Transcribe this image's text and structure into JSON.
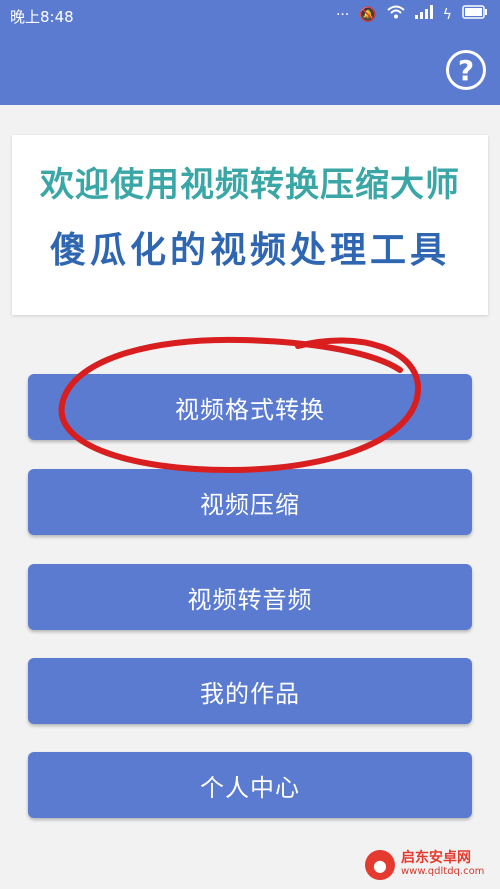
{
  "status_bar": {
    "time": "晚上8:48",
    "icons": [
      "more-icon",
      "mute-icon",
      "wifi-icon",
      "signal-icon",
      "charging-icon",
      "battery-icon"
    ]
  },
  "app_bar": {
    "help_glyph": "?"
  },
  "banner": {
    "line1": "欢迎使用视频转换压缩大师",
    "line2": "傻瓜化的视频处理工具"
  },
  "menu": [
    {
      "label": "视频格式转换"
    },
    {
      "label": "视频压缩"
    },
    {
      "label": "视频转音频"
    },
    {
      "label": "我的作品"
    },
    {
      "label": "个人中心"
    }
  ],
  "colors": {
    "primary": "#5a7bd0",
    "banner_teal": "#3aa7a6",
    "banner_blue": "#2f66b2",
    "annotation_red": "#d81e1e"
  },
  "watermark": {
    "title": "启东安卓网",
    "url": "www.qdltdq.com"
  }
}
